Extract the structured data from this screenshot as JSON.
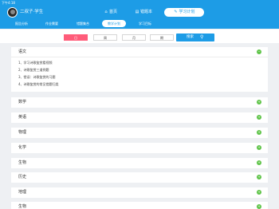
{
  "status_bar": {
    "time": "下午4:18"
  },
  "header": {
    "user_name": "二叔子·学生",
    "tabs": [
      {
        "label": "首页",
        "icon": "home-icon",
        "glyph": "⌂"
      },
      {
        "label": "错题本",
        "icon": "notebook-icon",
        "glyph": "▤"
      },
      {
        "label": "学习计划",
        "icon": "edit-icon",
        "glyph": "✎"
      }
    ],
    "active_tab": 2
  },
  "sub_nav": {
    "items": [
      {
        "label": "报告分析"
      },
      {
        "label": "作业需要"
      },
      {
        "label": "错题集合"
      },
      {
        "label": "教学计划"
      },
      {
        "label": "学习目标"
      }
    ],
    "active": 3
  },
  "toolbar": {
    "periods": [
      "日",
      "周",
      "月",
      "期"
    ],
    "active_period": 0,
    "search_label": "搜索"
  },
  "expanded_subject": {
    "name": "语文",
    "tasks": [
      "1、学习诗歌鉴赏看视频",
      "2、诗歌鉴赏三道例题",
      "3、错误：诗歌鉴赏的习题",
      "4、诗歌鉴赏的常见错题归类"
    ]
  },
  "subjects": [
    "数学",
    "英语",
    "物理",
    "化学",
    "生物",
    "历史",
    "地理",
    "生物"
  ],
  "colors": {
    "primary": "#1d9ce6",
    "active_period": "#ff5c7a",
    "toggle": "#5fc449"
  }
}
